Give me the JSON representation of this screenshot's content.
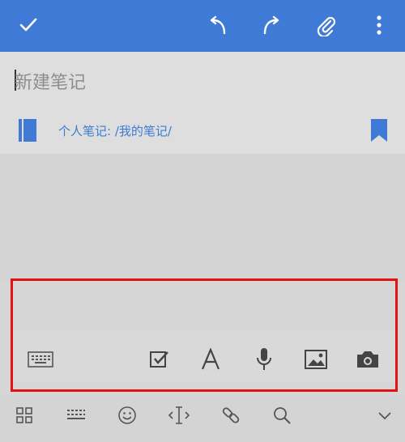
{
  "note": {
    "title_placeholder": "新建笔记",
    "notebook_path": "个人笔记: /我的笔记/"
  },
  "colors": {
    "brand": "#3f7bd6",
    "highlight_frame": "#e21212"
  },
  "topbar_icons": [
    "check-icon",
    "undo-icon",
    "redo-icon",
    "paperclip-icon",
    "more-vert-icon"
  ],
  "toolbox_icons": [
    "keyboard-icon",
    "checkbox-icon",
    "text-format-icon",
    "microphone-icon",
    "image-icon",
    "camera-icon"
  ],
  "bottom_icons": [
    "grid-icon",
    "keyboard-small-icon",
    "emoji-icon",
    "cursor-icon",
    "link-icon",
    "search-icon",
    "chevron-down-icon"
  ]
}
